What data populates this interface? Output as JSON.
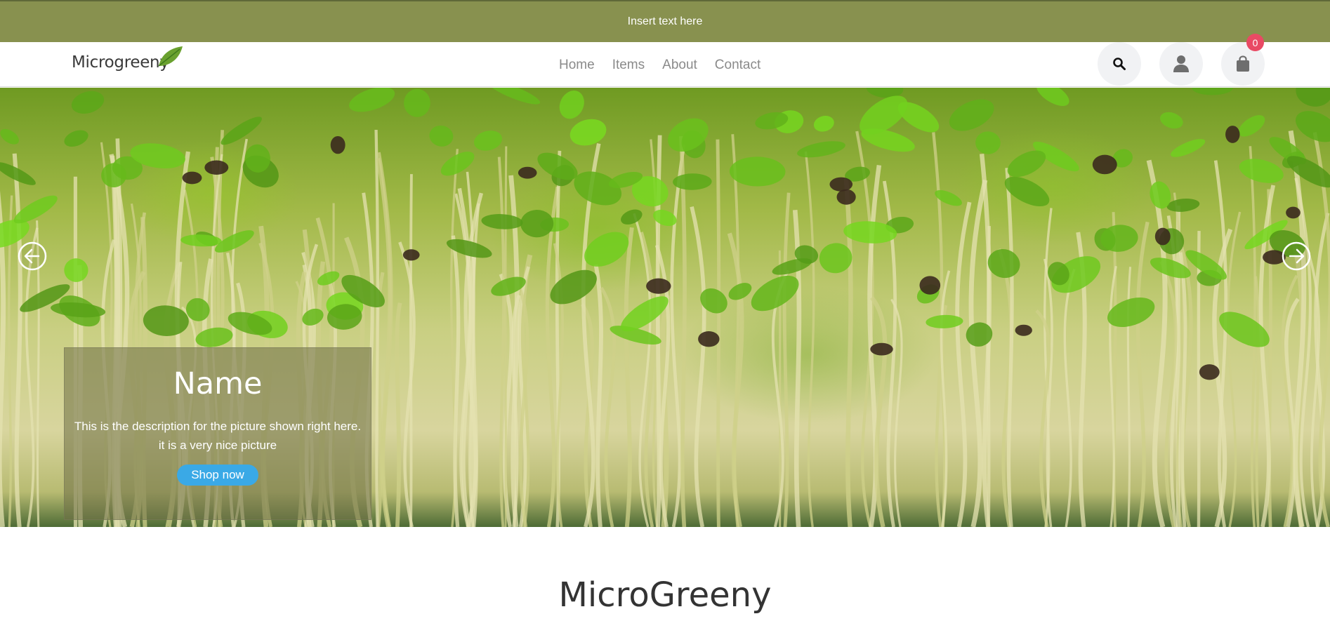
{
  "announcement": {
    "text": "Insert text here"
  },
  "header": {
    "logo_text": "Microgreeny",
    "nav": [
      {
        "label": "Home"
      },
      {
        "label": "Items"
      },
      {
        "label": "About"
      },
      {
        "label": "Contact"
      }
    ],
    "icons": {
      "search": "search-icon",
      "user": "user-icon",
      "cart": "shopping-bag-icon"
    },
    "cart_count": "0"
  },
  "hero": {
    "caption_title": "Name",
    "caption_description": "This is the description for the picture shown right here. it is a very nice picture",
    "cta_label": "Shop now",
    "controls": {
      "prev": "arrow-left-circle-icon",
      "next": "arrow-right-circle-icon"
    }
  },
  "section": {
    "heading": "MicroGreeny"
  },
  "colors": {
    "announcement_bg": "#88914f",
    "cta": "#3aa9e6",
    "badge": "#e94a64",
    "icon_button_bg": "#f1f2f4"
  }
}
